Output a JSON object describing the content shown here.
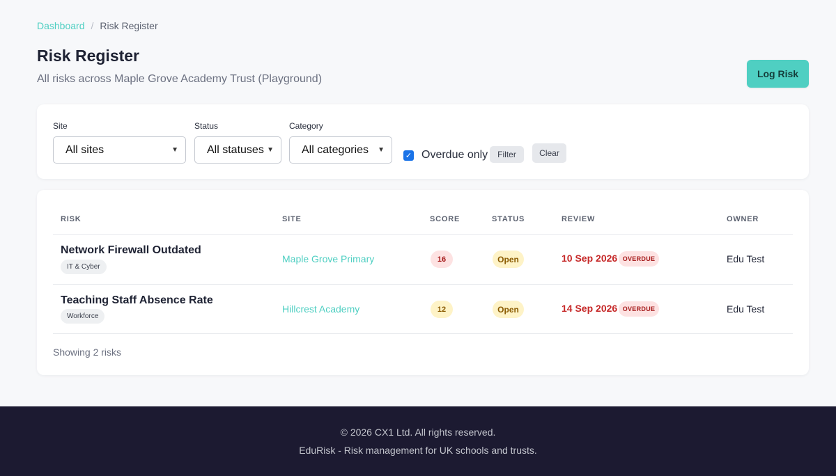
{
  "breadcrumb": {
    "home": "Dashboard",
    "separator": "/",
    "current": "Risk Register"
  },
  "header": {
    "title": "Risk Register",
    "subtitle": "All risks across Maple Grove Academy Trust (Playground)",
    "log_button": "Log Risk"
  },
  "filters": {
    "site": {
      "label": "Site",
      "selected": "All sites"
    },
    "status": {
      "label": "Status",
      "selected": "All statuses"
    },
    "category": {
      "label": "Category",
      "selected": "All categories"
    },
    "overdue": {
      "label": "Overdue only",
      "checked": true
    },
    "filter_button": "Filter",
    "clear_button": "Clear"
  },
  "table": {
    "columns": [
      "RISK",
      "SITE",
      "SCORE",
      "STATUS",
      "REVIEW",
      "OWNER"
    ],
    "rows": [
      {
        "risk": "Network Firewall Outdated",
        "category": "IT & Cyber",
        "site": "Maple Grove Primary",
        "score": "16",
        "status": "Open",
        "review": "10 Sep 2026",
        "badge": "OVERDUE",
        "owner": "Edu Test"
      },
      {
        "risk": "Teaching Staff Absence Rate",
        "category": "Workforce",
        "site": "Hillcrest Academy",
        "score": "12",
        "status": "Open",
        "review": "14 Sep 2026",
        "badge": "OVERDUE",
        "owner": "Edu Test"
      }
    ],
    "footer": "Showing 2 risks"
  },
  "footer": {
    "copyright": "© 2026 CX1 Ltd. All rights reserved.",
    "tagline": "EduRisk - Risk management for UK schools and trusts."
  },
  "colors": {
    "accent": "#4fcfc2",
    "danger": "#c62828",
    "footer_bg": "#1c1a31"
  }
}
